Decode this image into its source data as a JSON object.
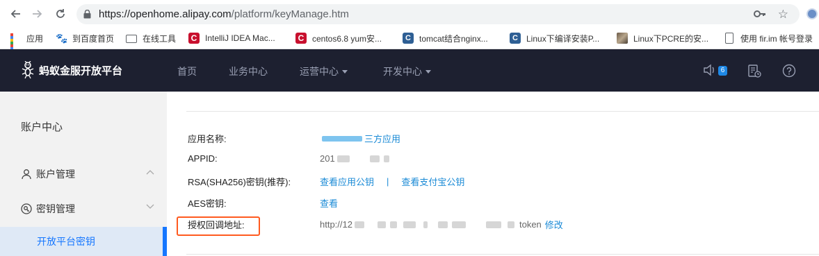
{
  "browser": {
    "url_host": "https://openhome.alipay.com",
    "url_path": "/platform/keyManage.htm",
    "icons": [
      "back-arrow-icon",
      "forward-arrow-icon",
      "reload-icon",
      "lock-icon",
      "key-icon",
      "star-icon"
    ]
  },
  "bookmarks": [
    {
      "label": "应用",
      "icon": "apps-grid-icon"
    },
    {
      "label": "到百度首页",
      "icon": "baidu-paw-icon"
    },
    {
      "label": "在线工具",
      "icon": "folder-icon"
    },
    {
      "label": "IntelliJ IDEA Mac...",
      "icon": "red-c-icon"
    },
    {
      "label": "centos6.8 yum安...",
      "icon": "red-c-icon"
    },
    {
      "label": "tomcat结合nginx...",
      "icon": "blue-c-icon"
    },
    {
      "label": "Linux下编译安装P...",
      "icon": "blue-c-icon"
    },
    {
      "label": "Linux下PCRE的安...",
      "icon": "photo-icon"
    },
    {
      "label": "使用 fir.im 帐号登录",
      "icon": "document-icon"
    }
  ],
  "topnav": {
    "brand": "蚂蚁金服开放平台",
    "items": [
      {
        "label": "首页",
        "dropdown": false
      },
      {
        "label": "业务中心",
        "dropdown": false
      },
      {
        "label": "运营中心",
        "dropdown": true
      },
      {
        "label": "开发中心",
        "dropdown": true
      }
    ],
    "notification_count": "6"
  },
  "sidebar": {
    "title": "账户中心",
    "items": [
      {
        "label": "账户管理",
        "icon": "user-icon",
        "expanded": true
      },
      {
        "label": "密钥管理",
        "icon": "key-circle-icon",
        "expanded": false
      }
    ],
    "active_sub": "开放平台密钥"
  },
  "main": {
    "rows": {
      "app_name": {
        "label": "应用名称:",
        "value_suffix": "三方应用"
      },
      "appid": {
        "label": "APPID:",
        "value_prefix": "201"
      },
      "rsa": {
        "label": "RSA(SHA256)密钥(推荐):",
        "link1": "查看应用公钥",
        "separator": "|",
        "link2": "查看支付宝公钥"
      },
      "aes": {
        "label": "AES密钥:",
        "link": "查看"
      },
      "callback": {
        "label": "授权回调地址:",
        "value_prefix": "http://12",
        "value_suffix": "token",
        "edit_link": "修改"
      }
    }
  },
  "colors": {
    "topnav_bg": "#1d2030",
    "link": "#1a8ad6",
    "active": "#1677ff",
    "highlight_border": "#ff5a1f",
    "sidebar_bg": "#f2f2f2"
  }
}
